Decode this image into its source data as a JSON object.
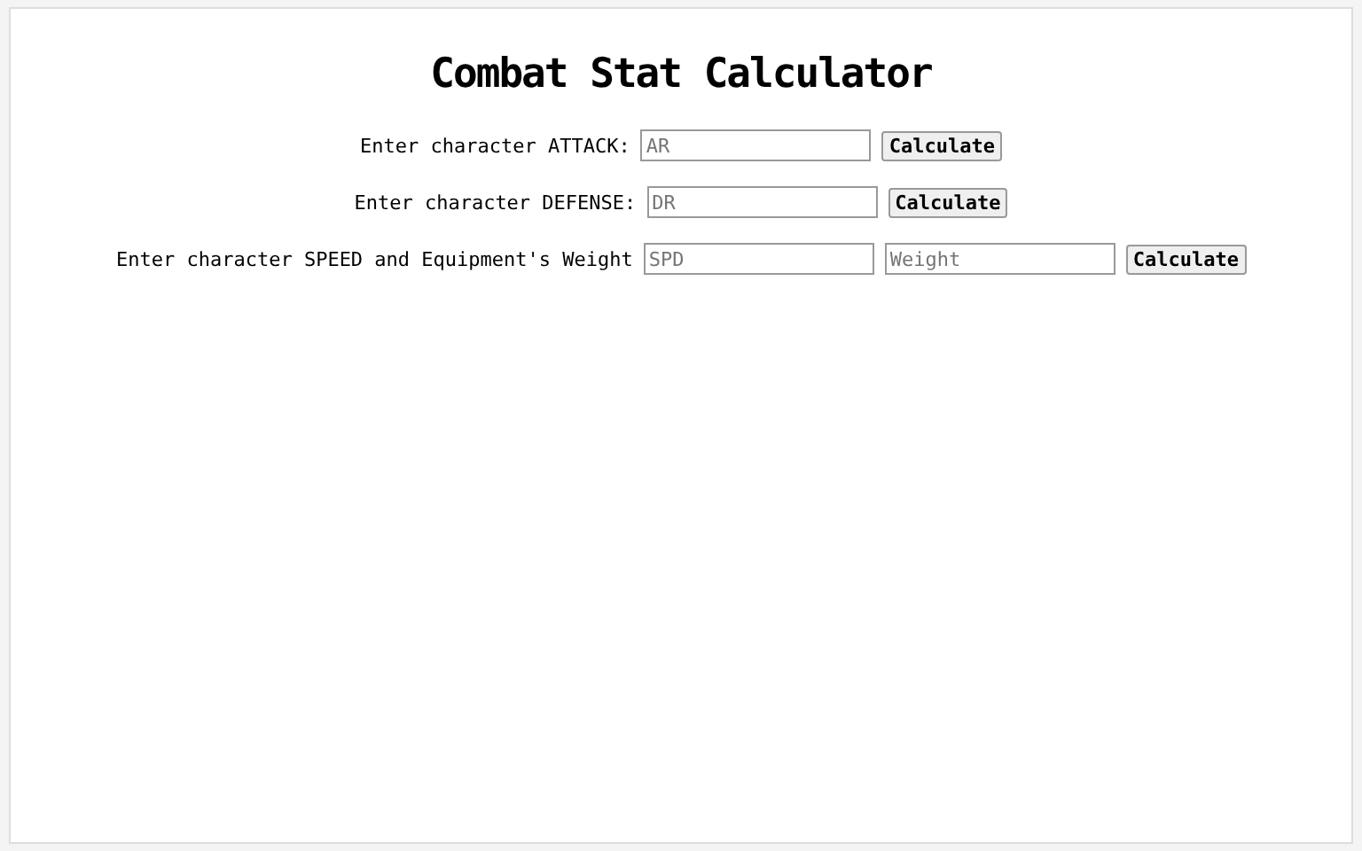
{
  "title": "Combat Stat Calculator",
  "rows": [
    {
      "label": "Enter character ATTACK:",
      "fields": [
        {
          "placeholder": "AR"
        }
      ],
      "button": "Calculate"
    },
    {
      "label": "Enter character DEFENSE:",
      "fields": [
        {
          "placeholder": "DR"
        }
      ],
      "button": "Calculate"
    },
    {
      "label": "Enter character SPEED and Equipment's Weight",
      "fields": [
        {
          "placeholder": "SPD"
        },
        {
          "placeholder": "Weight"
        }
      ],
      "button": "Calculate"
    }
  ]
}
